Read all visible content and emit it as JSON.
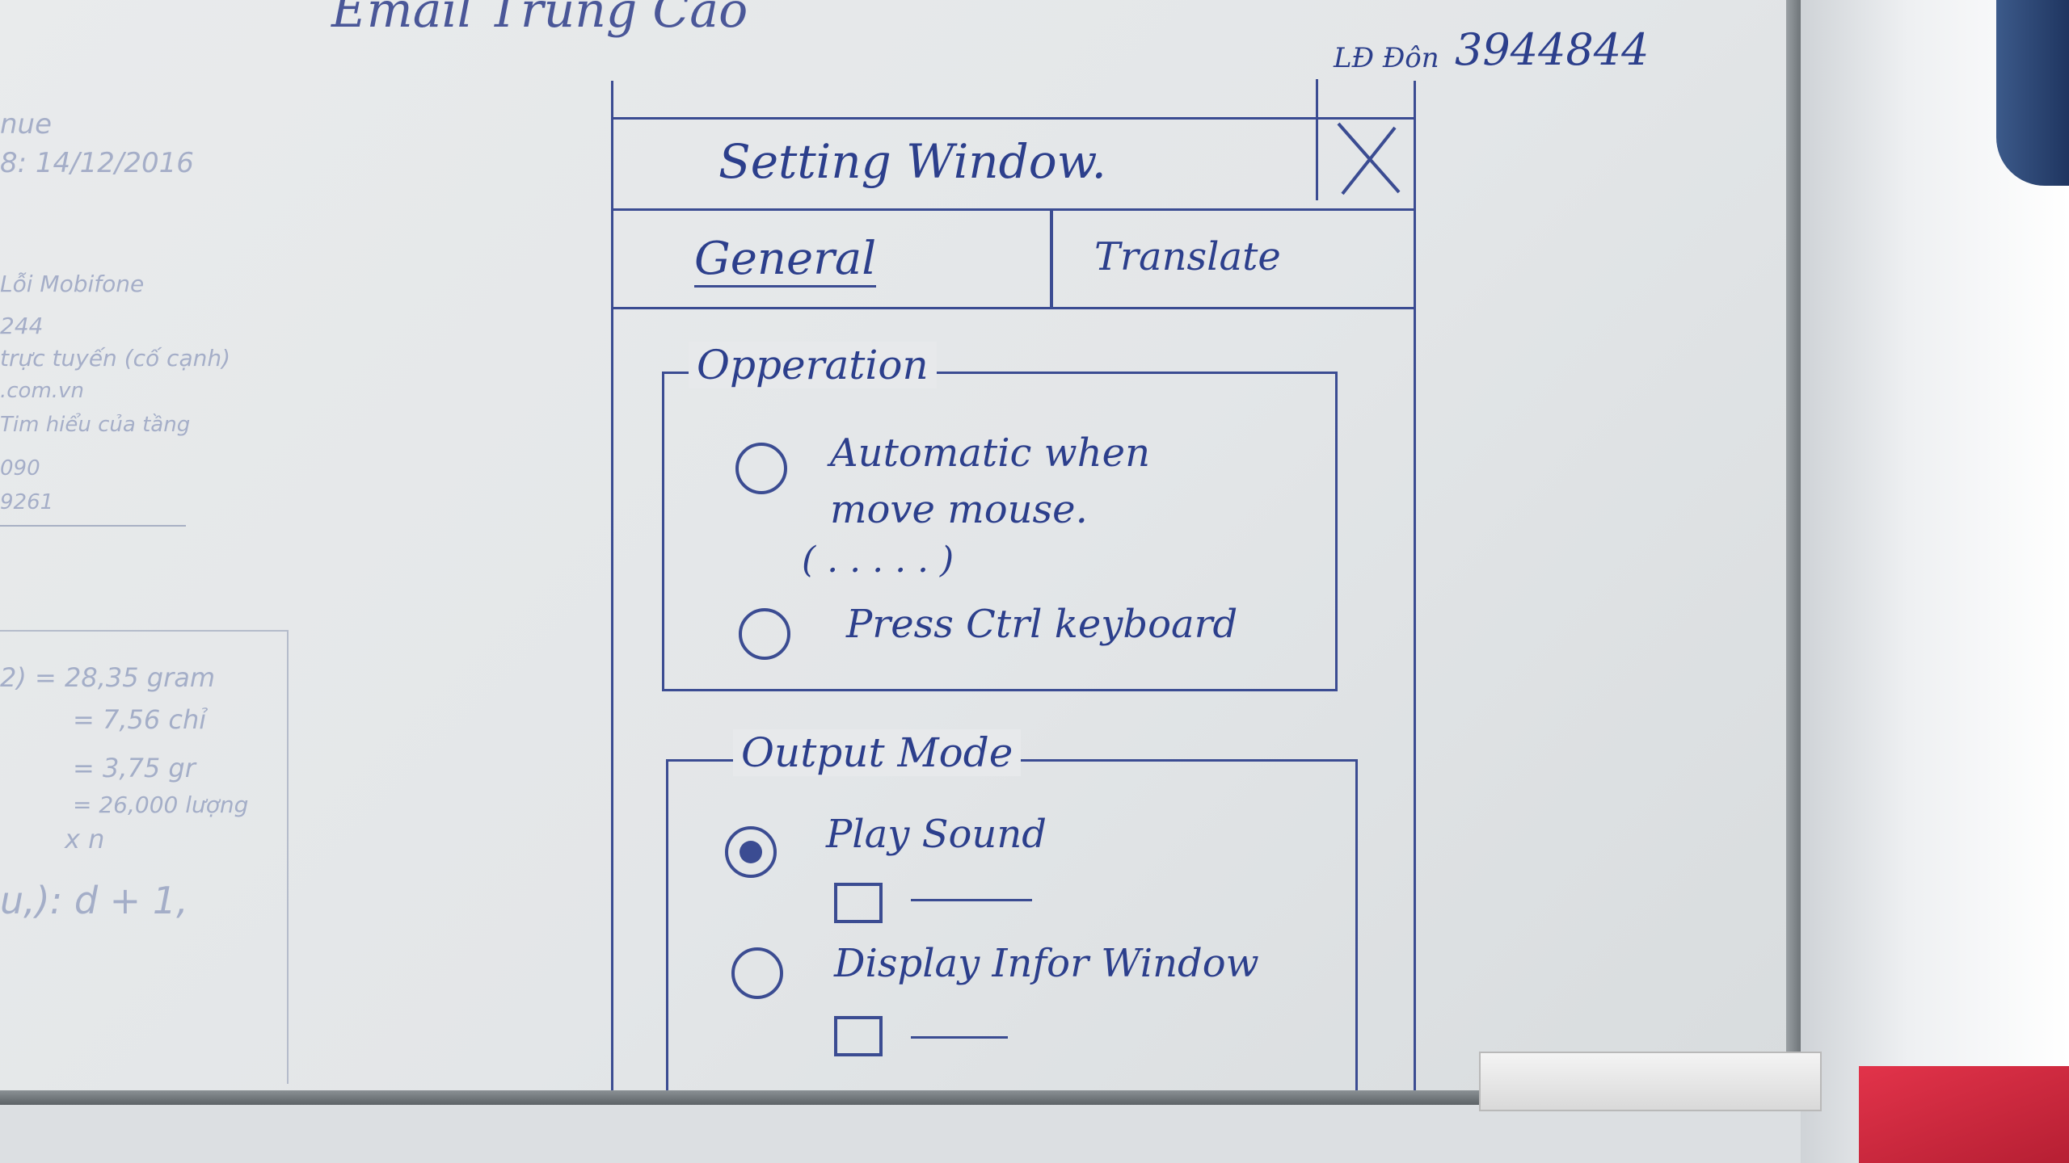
{
  "board_notes": {
    "top_header": "Email Trung Cao",
    "date_line": "nue\n8: 14/12/2016",
    "phone_label": "LĐ Đôn",
    "phone_number": "3944844",
    "side_notes": [
      "Lỗi Mobifone",
      "244",
      "trực tuyến (cố cạnh)",
      ".com.vn",
      "Tim hiểu của tầng",
      "090",
      "9261"
    ],
    "calc_notes": [
      "2)  = 28,35 gram",
      "= 7,56 chỉ",
      "= 3,75 gr",
      "= 26,000 lượng",
      "x n",
      "u,): d + 1,"
    ]
  },
  "window": {
    "title": "Setting Window.",
    "tabs": [
      {
        "label": "General"
      },
      {
        "label": "Translate"
      }
    ],
    "operation_group": {
      "legend": "Opperation",
      "options": [
        {
          "label_line1": "Automatic when",
          "label_line2": "move mouse.",
          "label_line3": "( . . . . . )",
          "checked": false
        },
        {
          "label_line1": "Press Ctrl keyboard",
          "checked": false
        }
      ]
    },
    "output_group": {
      "legend": "Output Mode",
      "options": [
        {
          "label": "Play Sound",
          "checked": true
        },
        {
          "label": "Display Infor Window",
          "checked": false
        }
      ]
    }
  },
  "colors": {
    "ink": "#3b4c92",
    "board": "#e7e9eb"
  }
}
